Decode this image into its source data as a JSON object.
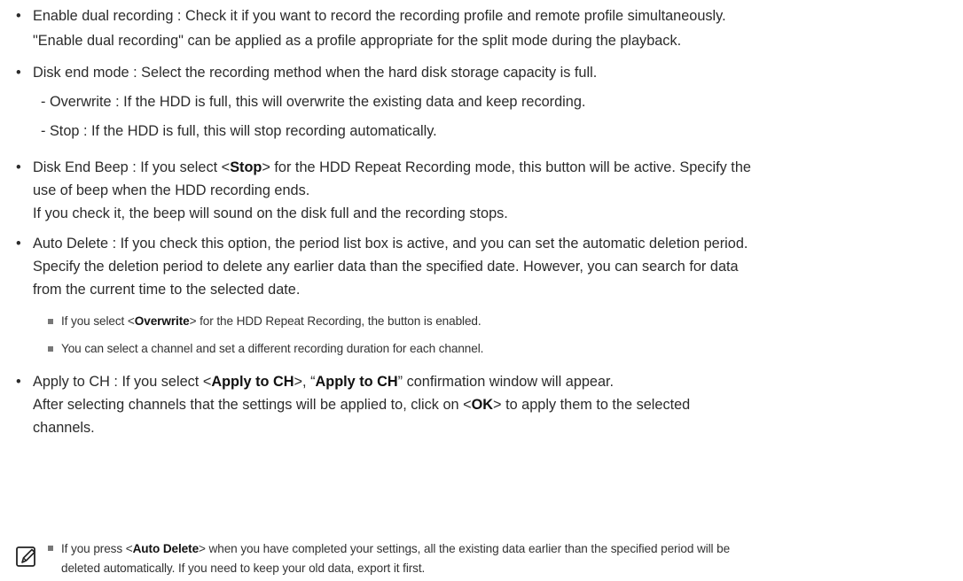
{
  "items": {
    "dual": {
      "label": "Enable dual recording",
      "text1": " : Check it if you want to record the recording profile and remote profile simultaneously.",
      "text2": "\"Enable dual recording\" can be applied as a profile appropriate for the split mode during the playback."
    },
    "disk_end": {
      "label": "Disk end mode",
      "text": " : Select the recording method when the hard disk storage capacity is full.",
      "overwrite": "-  Overwrite : If the HDD is full, this will overwrite the existing data and keep recording.",
      "stop": "-  Stop : If the HDD is full, this will stop recording automatically."
    },
    "beep": {
      "pre": "Disk End Beep : If you select <",
      "bold": "Stop",
      "post": "> for the HDD Repeat Recording mode, this button will be active. Specify the",
      "line2": "use of beep when the HDD recording ends.",
      "line3": "If you check it, the beep will sound on the disk full and the recording stops."
    },
    "auto_delete": {
      "line1": "Auto Delete : If you check this option, the period list box is active, and you can set the automatic deletion period.",
      "line2": "Specify the deletion period to delete any earlier data than the specified date. However, you can search for data",
      "line3": "from the current time to the selected date.",
      "note1_pre": "If you select <",
      "note1_bold": "Overwrite",
      "note1_post": "> for the HDD Repeat Recording, the button is enabled.",
      "note2": "You can select a channel and set a different recording duration for each channel."
    },
    "apply": {
      "pre": "Apply to CH : If you select <",
      "bold1": "Apply to CH",
      "mid": ">, “",
      "bold2": "Apply to CH",
      "post": "” confirmation window will appear.",
      "line2_pre": "After selecting channels that the settings will be applied to, click on <",
      "line2_bold": "OK",
      "line2_post": "> to apply them to the selected",
      "line3": "channels."
    }
  },
  "memo": {
    "icon": "memo-pencil-icon",
    "pre": "If you press <",
    "bold": "Auto Delete",
    "post": "> when you have completed your settings, all the existing data earlier than the specified period will be",
    "line2": "deleted automatically. If you need to keep your old data, export it first."
  }
}
